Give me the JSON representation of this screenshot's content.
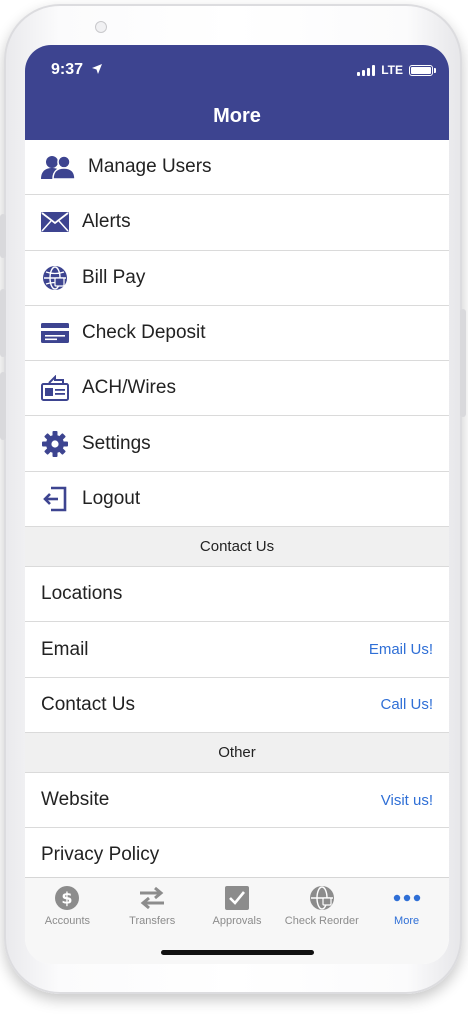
{
  "status_bar": {
    "time": "9:37",
    "network": "LTE"
  },
  "header": {
    "title": "More"
  },
  "menu_items": [
    {
      "label": "Manage Users",
      "icon": "users-icon"
    },
    {
      "label": "Alerts",
      "icon": "envelope-icon"
    },
    {
      "label": "Bill Pay",
      "icon": "globe-icon"
    },
    {
      "label": "Check Deposit",
      "icon": "check-card-icon"
    },
    {
      "label": "ACH/Wires",
      "icon": "wire-transfer-icon"
    },
    {
      "label": "Settings",
      "icon": "gear-icon"
    },
    {
      "label": "Logout",
      "icon": "logout-icon"
    }
  ],
  "contact_section": {
    "title": "Contact Us",
    "rows": [
      {
        "label": "Locations",
        "link": ""
      },
      {
        "label": "Email",
        "link": "Email Us!"
      },
      {
        "label": "Contact Us",
        "link": "Call Us!"
      }
    ]
  },
  "other_section": {
    "title": "Other",
    "rows": [
      {
        "label": "Website",
        "link": "Visit us!"
      },
      {
        "label": "Privacy Policy",
        "link": ""
      }
    ]
  },
  "tab_bar": {
    "tabs": [
      {
        "label": "Accounts",
        "icon": "dollar-icon"
      },
      {
        "label": "Transfers",
        "icon": "transfer-arrows-icon"
      },
      {
        "label": "Approvals",
        "icon": "checkbox-icon"
      },
      {
        "label": "Check Reorder",
        "icon": "globe-lock-icon"
      },
      {
        "label": "More",
        "icon": "more-dots-icon"
      }
    ],
    "active": "More"
  },
  "colors": {
    "brand": "#3d4490",
    "link": "#2f6fd6",
    "section_bg": "#f0f0f0",
    "tab_inactive": "#8c8c8c"
  }
}
